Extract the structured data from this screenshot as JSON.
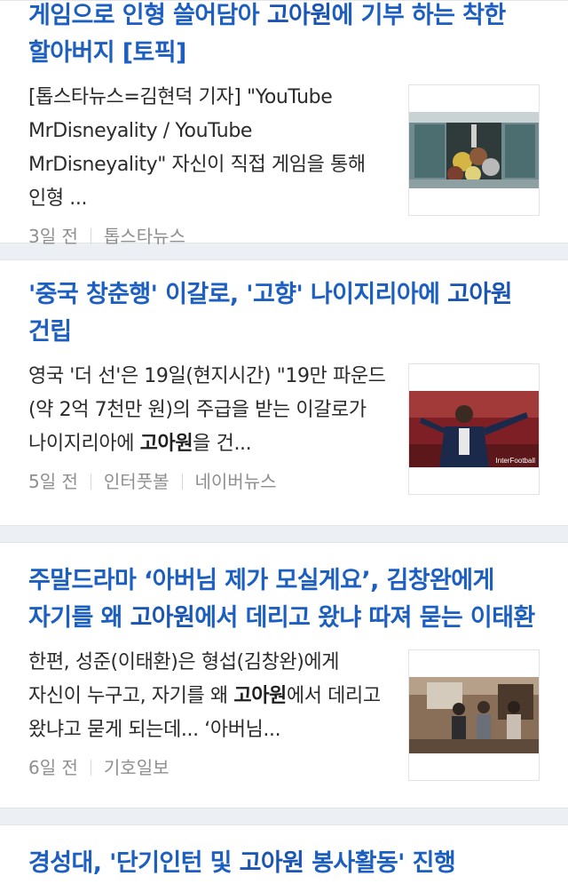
{
  "articles": [
    {
      "title_pre": "게임으로 인형 쓸어담아 ",
      "title_kw": "고아원",
      "title_post": "에 기부 하는 착한 할아버지 [토픽]",
      "snippet_pre": "[톱스타뉴스=김현덕 기자] \"YouTube MrDisneyality / YouTube MrDisneyality\" 자신이 직접 게임을 통해 인형 ...",
      "snippet_kw": "",
      "snippet_post": "",
      "age": "3일 전",
      "source": "톱스타뉴스",
      "source2": ""
    },
    {
      "title_pre": "'중국 창춘행' 이갈로, '고향' 나이지리아에 ",
      "title_kw": "고아원",
      "title_post": " 건립",
      "snippet_pre": "영국 '더 선'은 19일(현지시간) \"19만 파운드(약 2억 7천만 원)의 주급을 받는 이갈로가 나이지리아에 ",
      "snippet_kw": "고아원",
      "snippet_post": "을 건...",
      "age": "5일 전",
      "source": "인터풋볼",
      "source2": "네이버뉴스",
      "thumb_caption": "InterFootball"
    },
    {
      "title_pre": "주말드라마 ‘아버님 제가 모실게요’, 김창완에게 자기를 왜 ",
      "title_kw": "고아원",
      "title_post": "에서 데리고 왔냐 따져 묻는 이태환",
      "snippet_pre": "한편, 성준(이태환)은 형섭(김창완)에게 자신이 누구고, 자기를 왜 ",
      "snippet_kw": "고아원",
      "snippet_post": "에서 데리고 왔냐고 묻게 되는데... ‘아버님...",
      "age": "6일 전",
      "source": "기호일보",
      "source2": ""
    },
    {
      "title_pre": "경성대, '단기인턴 및 ",
      "title_kw": "고아원",
      "title_post": " 봉사활동' 진행"
    }
  ]
}
